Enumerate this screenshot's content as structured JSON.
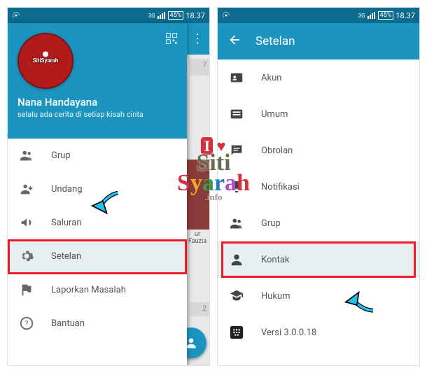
{
  "status": {
    "battery": "45%",
    "time": "18.37"
  },
  "left": {
    "avatar_label": "SitiSyarah",
    "name": "Nana Handayana",
    "motto": "selalu ada cerita di setiap kisah cinta",
    "menu": [
      {
        "label": "Grup"
      },
      {
        "label": "Undang"
      },
      {
        "label": "Saluran"
      },
      {
        "label": "Setelan"
      },
      {
        "label": "Laporkan Masalah"
      },
      {
        "label": "Bantuan"
      }
    ],
    "behind_caption": "ur Fauzia"
  },
  "right": {
    "title": "Setelan",
    "items": [
      {
        "label": "Akun"
      },
      {
        "label": "Umum"
      },
      {
        "label": "Obrolan"
      },
      {
        "label": "Notifikasi"
      },
      {
        "label": "Grup"
      },
      {
        "label": "Kontak"
      },
      {
        "label": "Hukum"
      },
      {
        "label": "Versi 3.0.0.18"
      }
    ]
  },
  "watermark": {
    "line1_a": "I",
    "line1_b": "♥",
    "line2": "Siti",
    "line3": "Syarah",
    "line4": ".info"
  }
}
